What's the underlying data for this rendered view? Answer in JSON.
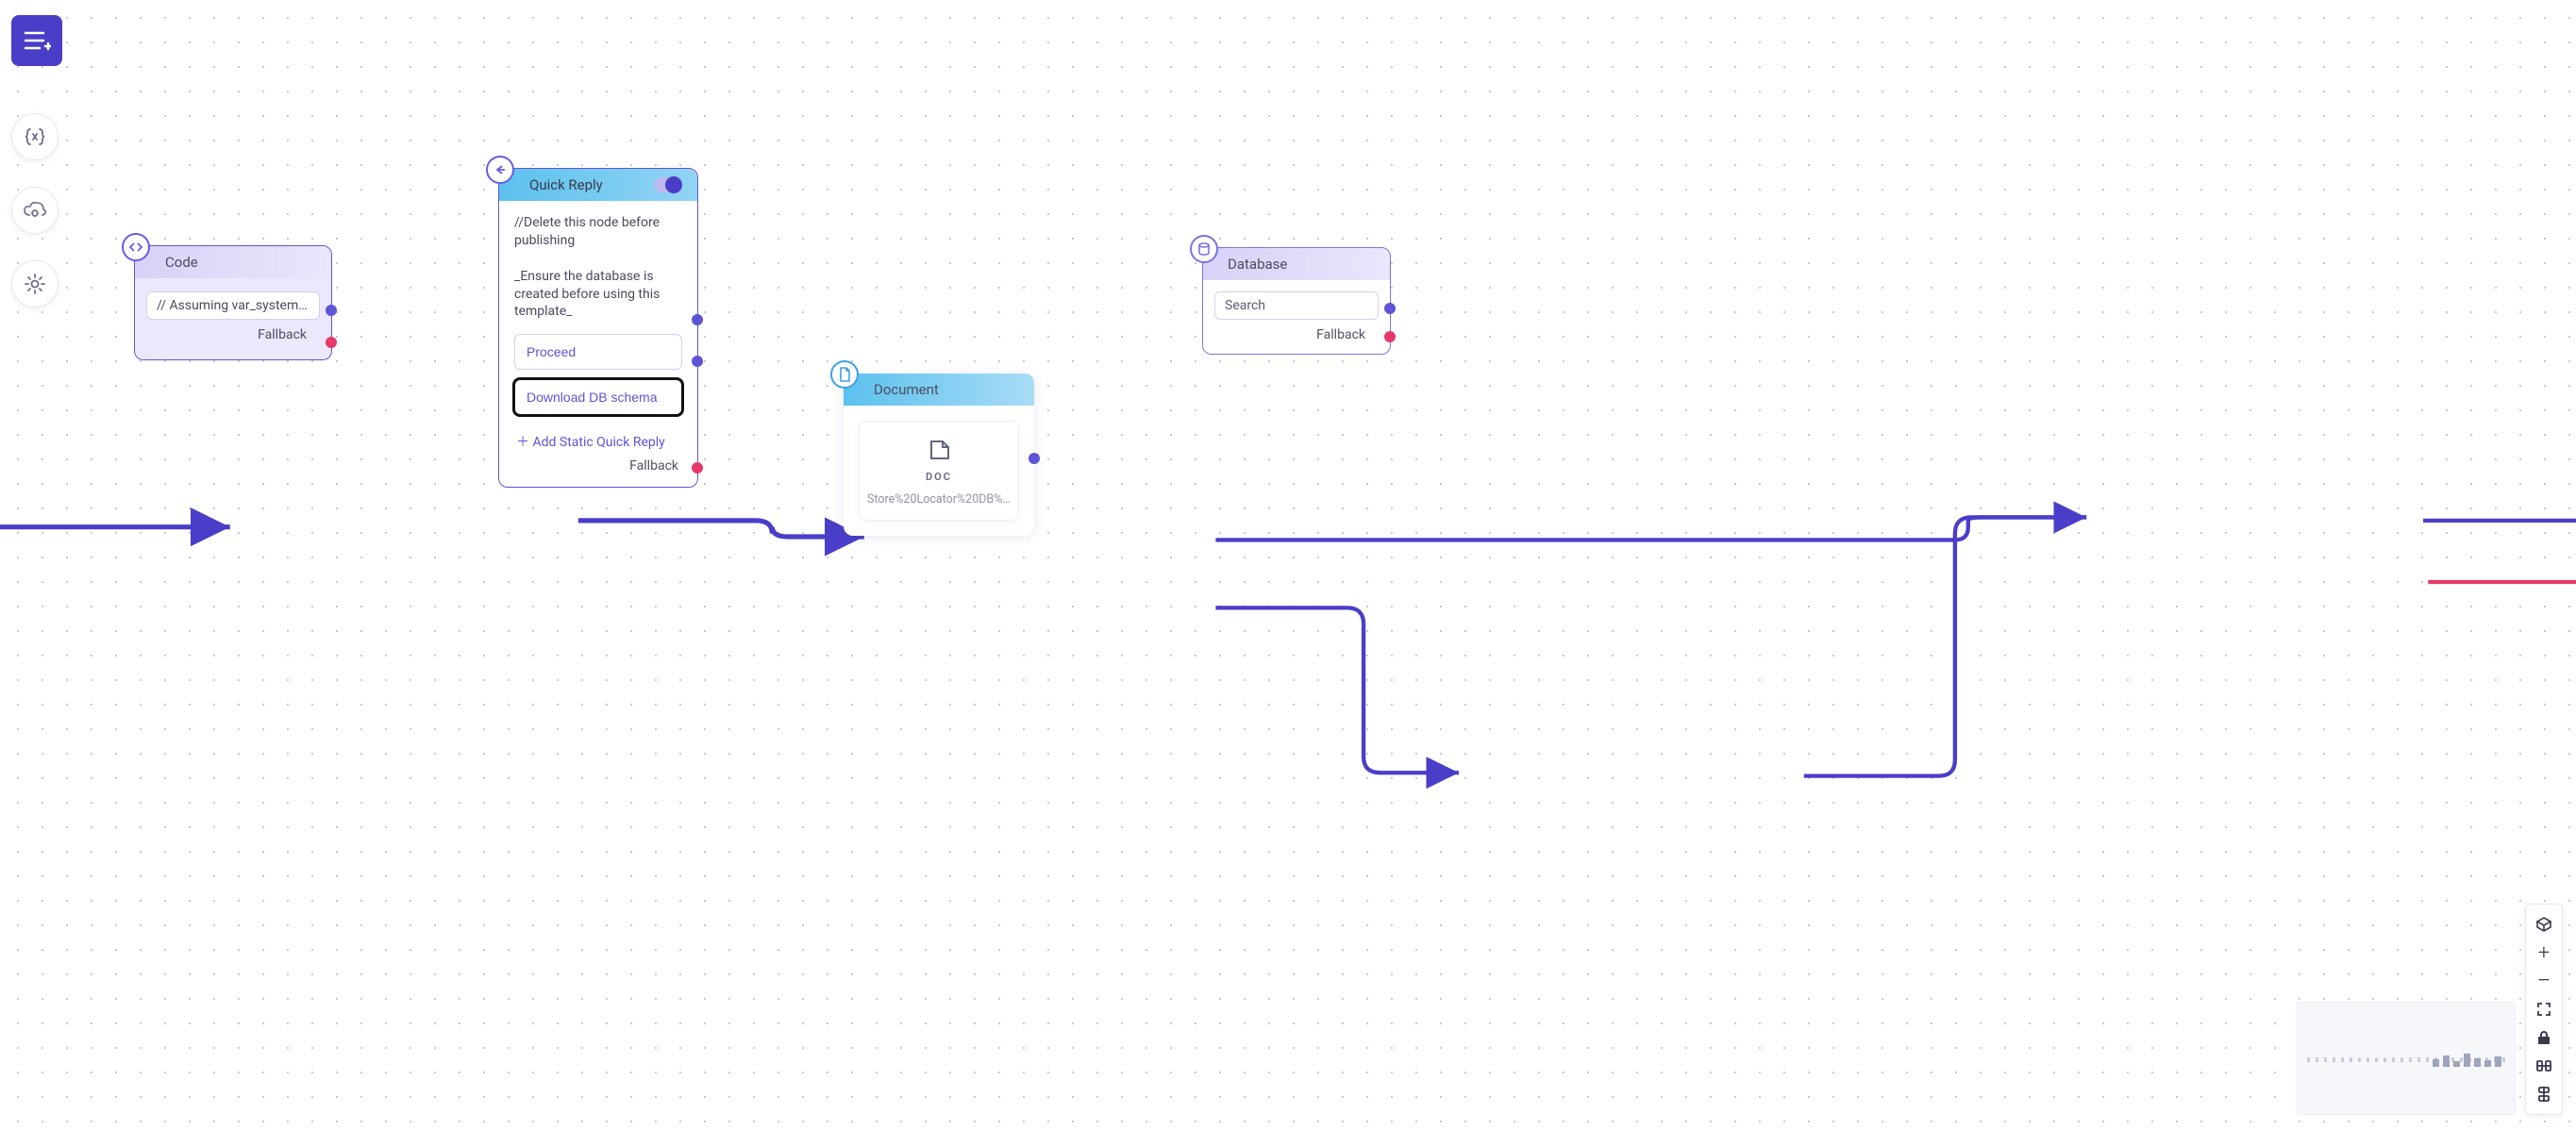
{
  "colors": {
    "primary": "#4a3ec9",
    "accent": "#5f54d6",
    "sky": "#5cc1ee",
    "red": "#e53969"
  },
  "toolbar": {
    "hamburger_name": "menu-toggle",
    "side_icons": [
      "variables-icon",
      "cloud-settings-icon",
      "gear-icon"
    ]
  },
  "nodes": {
    "code": {
      "title": "Code",
      "chip": "// Assuming var_system....",
      "fallback": "Fallback"
    },
    "quick_reply": {
      "title": "Quick Reply",
      "desc_line1": "//Delete this node before publishing",
      "desc_line2": "_Ensure the database is created before using this template_",
      "options": [
        {
          "label": "Proceed",
          "highlight": false
        },
        {
          "label": "Download DB schema",
          "highlight": true
        }
      ],
      "add_label": "Add Static Quick Reply",
      "fallback": "Fallback"
    },
    "document": {
      "title": "Document",
      "doc_type": "DOC",
      "filename": "Store%20Locator%20DB%20S..."
    },
    "database": {
      "title": "Database",
      "action": "Search",
      "fallback": "Fallback"
    }
  },
  "controls": {
    "zoom_in": "+",
    "zoom_out": "−"
  }
}
